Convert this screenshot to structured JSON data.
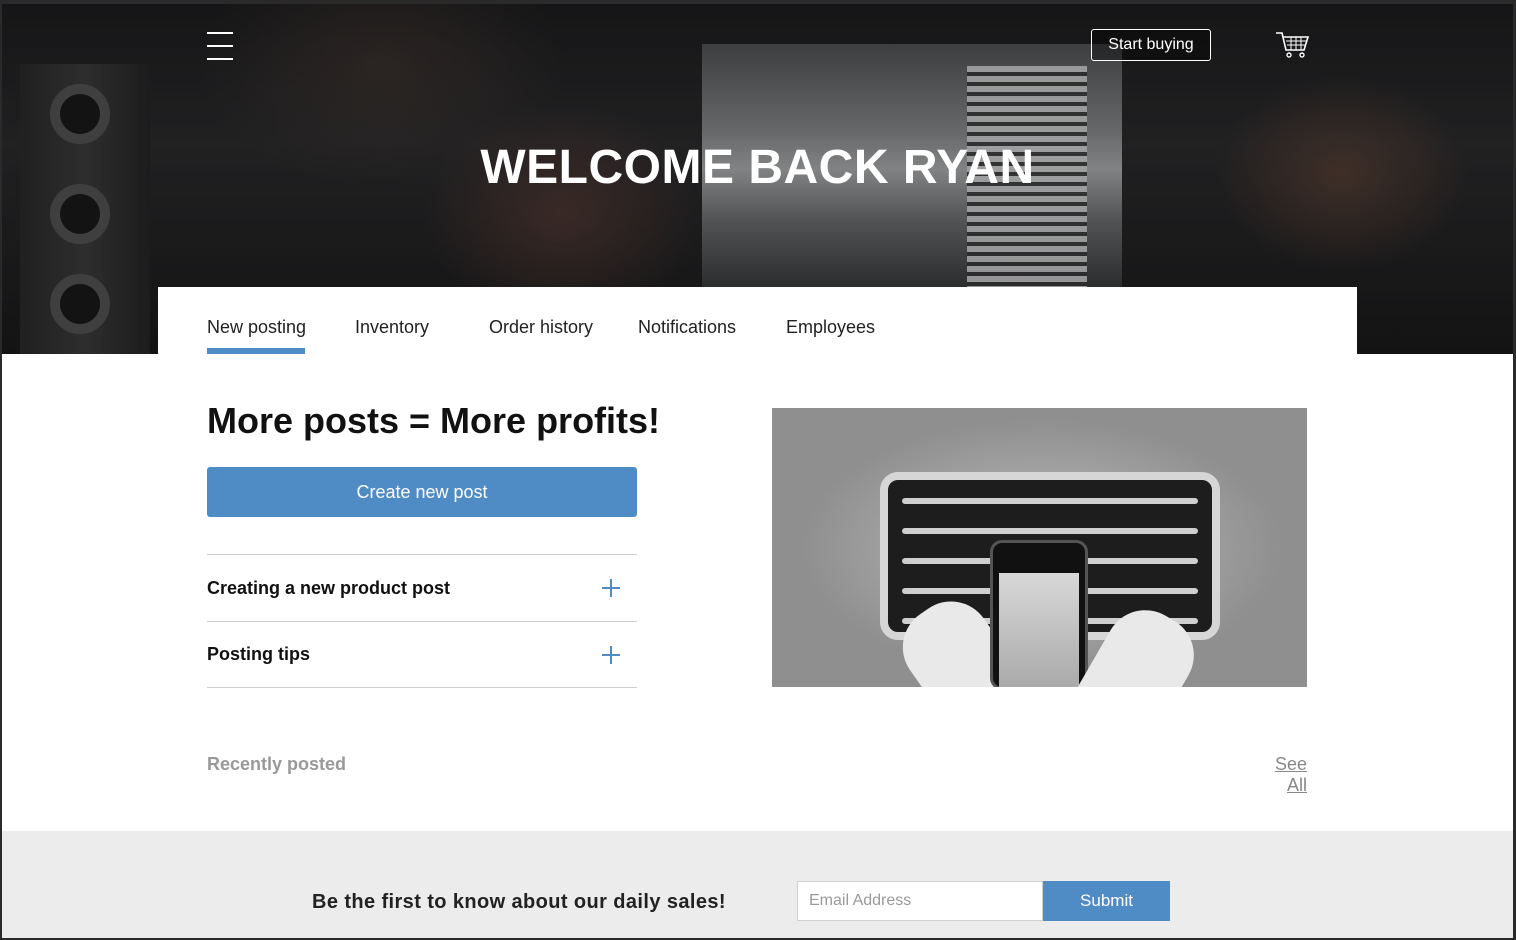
{
  "header": {
    "start_buying_label": "Start buying",
    "title": "WELCOME BACK RYAN"
  },
  "tabs": [
    {
      "label": "New posting",
      "active": true
    },
    {
      "label": "Inventory",
      "active": false
    },
    {
      "label": "Order history",
      "active": false
    },
    {
      "label": "Notifications",
      "active": false
    },
    {
      "label": "Employees",
      "active": false
    }
  ],
  "main": {
    "headline": "More posts = More profits!",
    "create_button": "Create new post",
    "accordion": [
      {
        "label": "Creating a new product post"
      },
      {
        "label": "Posting tips"
      }
    ],
    "recently_posted_label": "Recently posted",
    "see_all_label": "See All"
  },
  "newsletter": {
    "text": "Be the first to know about our daily sales!",
    "email_placeholder": "Email Address",
    "submit_label": "Submit"
  },
  "colors": {
    "accent": "#4f8bc4",
    "footer_bg": "#ececec"
  },
  "icons": {
    "menu": "hamburger-menu-icon",
    "cart": "shopping-cart-icon",
    "expand": "plus-icon"
  }
}
